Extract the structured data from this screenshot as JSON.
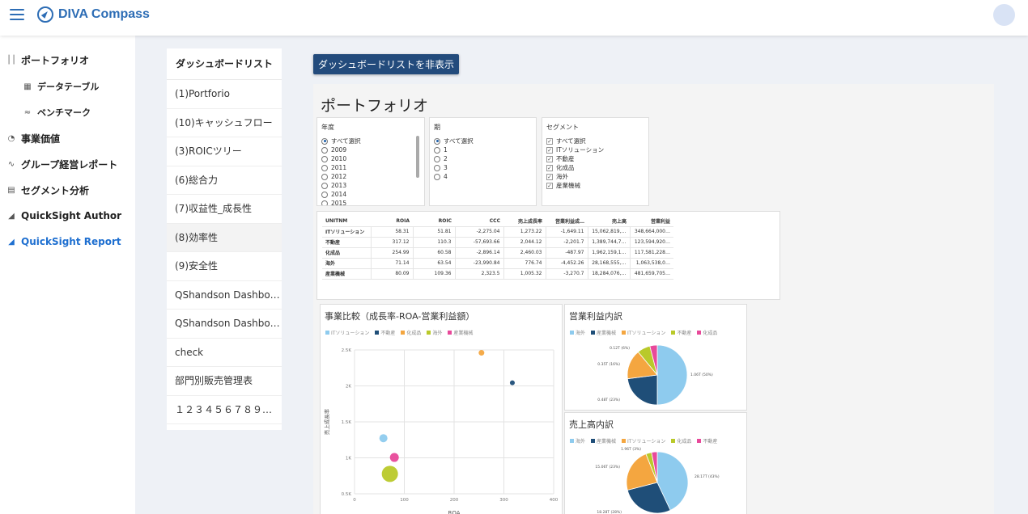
{
  "app": {
    "title": "DIVA Compass"
  },
  "sidebar": {
    "items": [
      {
        "label": "ポートフォリオ",
        "icon": "bar-chart-icon"
      },
      {
        "label": "データテーブル",
        "icon": "table-icon"
      },
      {
        "label": "ベンチマーク",
        "icon": "line-chart-icon"
      },
      {
        "label": "事業価値",
        "icon": "pie-chart-icon"
      },
      {
        "label": "グループ経営レポート",
        "icon": "pulse-icon"
      },
      {
        "label": "セグメント分析",
        "icon": "segment-icon"
      },
      {
        "label": "QuickSight Author",
        "icon": "area-chart-icon"
      },
      {
        "label": "QuickSight Report",
        "icon": "area-chart-icon"
      }
    ]
  },
  "dashboard_list": {
    "header": "ダッシュボードリスト",
    "items": [
      "(1)Portforio",
      "(10)キャッシュフロー",
      "(3)ROICツリー",
      "(6)総合力",
      "(7)収益性_成長性",
      "(8)効率性",
      "(9)安全性",
      "QShandson Dashbo…",
      "QShandson Dashbo…",
      "check",
      "部門別販売管理表",
      "１２３４５６７８９…"
    ]
  },
  "hide_button": {
    "label": "ダッシュボードリストを非表示"
  },
  "dashboard": {
    "title": "ポートフォリオ",
    "filters": {
      "year": {
        "title": "年度",
        "options": [
          "すべて選択",
          "2009",
          "2010",
          "2011",
          "2012",
          "2013",
          "2014",
          "2015"
        ]
      },
      "period": {
        "title": "期",
        "options": [
          "すべて選択",
          "1",
          "2",
          "3",
          "4"
        ]
      },
      "segment": {
        "title": "セグメント",
        "options": [
          "すべて選択",
          "ITソリューション",
          "不動産",
          "化成品",
          "海外",
          "産業機械"
        ]
      }
    },
    "table": {
      "headers": [
        "UNITNM",
        "ROIA",
        "ROIC",
        "CCC",
        "売上成長率",
        "営業利益成…",
        "売上高",
        "営業利益"
      ],
      "rows": [
        [
          "ITソリューション",
          "58.31",
          "51.81",
          "-2,275.04",
          "1,273.22",
          "-1,649.11",
          "15,062,819,…",
          "348,664,000…"
        ],
        [
          "不動産",
          "317.12",
          "110.3",
          "-57,693.66",
          "2,044.12",
          "-2,201.7",
          "1,389,744,7…",
          "123,594,920…"
        ],
        [
          "化成品",
          "254.99",
          "60.58",
          "-2,896.14",
          "2,460.03",
          "-487.97",
          "1,962,159,1…",
          "117,581,228…"
        ],
        [
          "海外",
          "71.14",
          "63.54",
          "-23,990.84",
          "776.74",
          "-4,452.26",
          "28,168,555,…",
          "1,063,538,0…"
        ],
        [
          "産業機械",
          "80.09",
          "109.36",
          "2,323.5",
          "1,005.32",
          "-3,270.7",
          "18,284,076,…",
          "481,659,705…"
        ]
      ]
    },
    "scatter": {
      "title": "事業比較（成長率-ROA-営業利益額）",
      "legend": [
        "ITソリューション",
        "不動産",
        "化成品",
        "海外",
        "産業機械"
      ]
    },
    "pie_op": {
      "title": "営業利益内訳",
      "legend": [
        "海外",
        "産業機械",
        "ITソリューション",
        "不動産",
        "化成品"
      ]
    },
    "pie_sales": {
      "title": "売上高内訳",
      "legend": [
        "海外",
        "産業機械",
        "ITソリューション",
        "化成品",
        "不動産"
      ]
    }
  },
  "colors": {
    "it": "#8ecbee",
    "realestate": "#1f4e78",
    "chemical": "#f4a640",
    "overseas": "#b9c92a",
    "machinery": "#e8499a",
    "accent": "#2d6db5"
  },
  "chart_data": [
    {
      "type": "scatter",
      "title": "事業比較（成長率-ROA-営業利益額）",
      "xlabel": "ROA",
      "ylabel": "売上成長率",
      "xlim": [
        0,
        400
      ],
      "ylim": [
        500,
        2500
      ],
      "xticks": [
        "0",
        "100",
        "200",
        "300",
        "400"
      ],
      "yticks": [
        "0.5K",
        "1K",
        "1.5K",
        "2K",
        "2.5K"
      ],
      "series": [
        {
          "name": "ITソリューション",
          "x": 58,
          "y": 1273,
          "color": "#8ecbee"
        },
        {
          "name": "不動産",
          "x": 317,
          "y": 2044,
          "color": "#1f4e78"
        },
        {
          "name": "化成品",
          "x": 255,
          "y": 2460,
          "color": "#f4a640"
        },
        {
          "name": "海外",
          "x": 71,
          "y": 777,
          "color": "#b9c92a"
        },
        {
          "name": "産業機械",
          "x": 80,
          "y": 1005,
          "color": "#e8499a"
        }
      ]
    },
    {
      "type": "pie",
      "title": "営業利益内訳",
      "labels": [
        "海外",
        "産業機械",
        "ITソリューション",
        "不動産",
        "化成品"
      ],
      "values": [
        50,
        23,
        16,
        7,
        4
      ],
      "data_labels": [
        "1.06T (50%)",
        "0.48T (23%)",
        "0.35T (16%)",
        "0.12T (6%)"
      ],
      "colors": [
        "#8ecbee",
        "#1f4e78",
        "#f4a640",
        "#b9c92a",
        "#e8499a"
      ]
    },
    {
      "type": "pie",
      "title": "売上高内訳",
      "labels": [
        "海外",
        "産業機械",
        "ITソリューション",
        "化成品",
        "不動産"
      ],
      "values": [
        43,
        28,
        23,
        3,
        3
      ],
      "data_labels": [
        "28.17T (43%)",
        "18.28T (28%)",
        "15.06T (23%)",
        "1.96T (3%)"
      ],
      "colors": [
        "#8ecbee",
        "#1f4e78",
        "#f4a640",
        "#b9c92a",
        "#e8499a"
      ]
    }
  ]
}
